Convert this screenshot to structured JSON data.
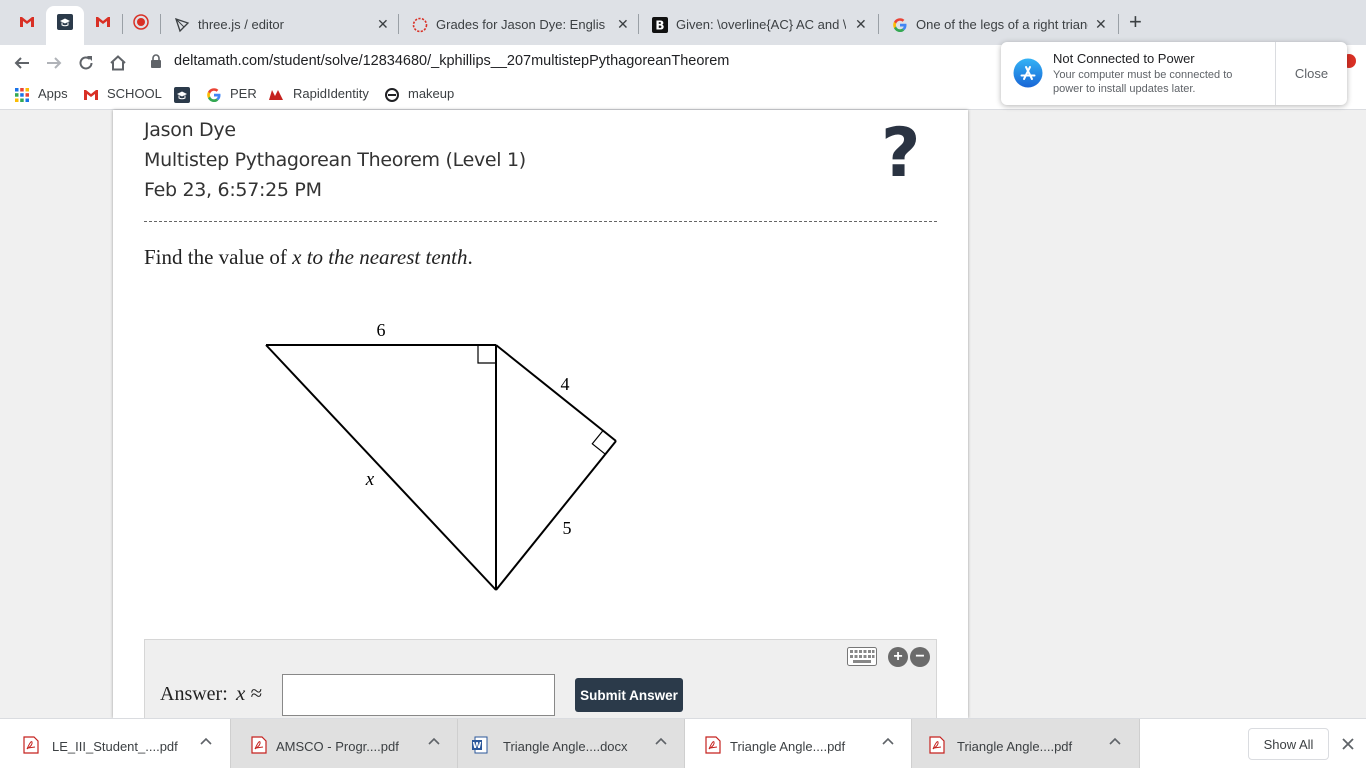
{
  "browser": {
    "tabs": [
      {
        "title": "",
        "icon": "gmail-icon"
      },
      {
        "title": "",
        "icon": "graduation-cap-icon"
      },
      {
        "title": "",
        "icon": "gmail-icon"
      },
      {
        "title": "",
        "icon": "record-icon"
      },
      {
        "title": "three.js / editor",
        "icon": "threejs-icon"
      },
      {
        "title": "Grades for Jason Dye: English",
        "icon": "canvas-icon"
      },
      {
        "title": "Given: \\overline{AC} AC and \\o",
        "icon": "b-icon"
      },
      {
        "title": "One of the legs of a right triang",
        "icon": "google-icon"
      }
    ],
    "url": "deltamath.com/student/solve/12834680/_kphillips__207multistepPythagoreanTheorem",
    "bookmarks": [
      "Apps",
      "SCHOOL",
      "",
      "PER",
      "RapidIdentity",
      "makeup"
    ]
  },
  "notification": {
    "title": "Not Connected to Power",
    "body": "Your computer must be connected to power to install updates later.",
    "close_label": "Close"
  },
  "problem": {
    "student": "Jason Dye",
    "skill": "Multistep Pythagorean Theorem (Level 1)",
    "timestamp": "Feb 23, 6:57:25 PM",
    "prompt_start": "Find the value of ",
    "prompt_var": "x",
    "prompt_tail": " to the nearest tenth",
    "prompt_end": ".",
    "figure_labels": {
      "top": "6",
      "upper_right": "4",
      "lower_right": "5",
      "hypotenuse": "x"
    },
    "answer_label": "Answer:",
    "answer_var": "x",
    "answer_symbol": "≈",
    "answer_value": "",
    "submit_label": "Submit Answer"
  },
  "downloads": {
    "items": [
      {
        "name": "LE_III_Student_....pdf",
        "type": "pdf"
      },
      {
        "name": "AMSCO - Progr....pdf",
        "type": "pdf"
      },
      {
        "name": "Triangle Angle....docx",
        "type": "docx"
      },
      {
        "name": "Triangle Angle....pdf",
        "type": "pdf"
      },
      {
        "name": "Triangle Angle....pdf",
        "type": "pdf"
      }
    ],
    "show_all_label": "Show All"
  },
  "colors": {
    "submit_bg": "#2b3a4a",
    "help_icon": "#2a3342",
    "tabstrip_bg": "#dee1e6",
    "gmail_red": "#d93025"
  }
}
